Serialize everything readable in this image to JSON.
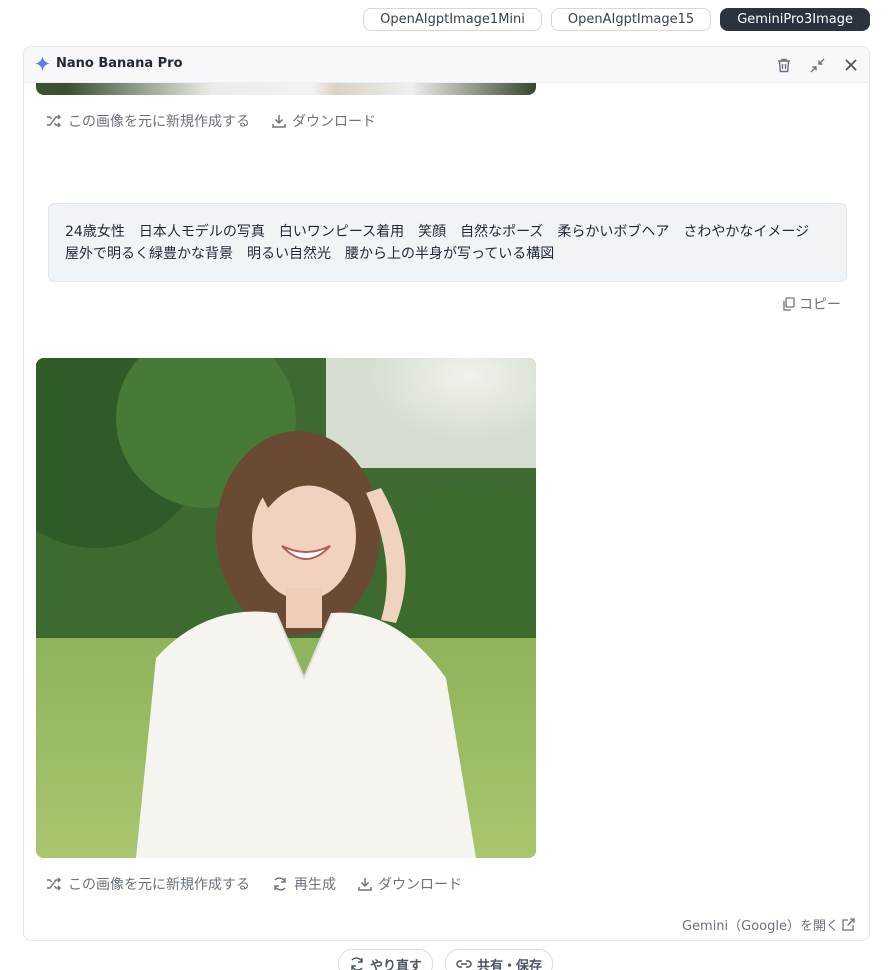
{
  "model_tabs": [
    {
      "label": "OpenAIgptImage1Mini",
      "active": false
    },
    {
      "label": "OpenAIgptImage15",
      "active": false
    },
    {
      "label": "GeminiPro3Image",
      "active": true
    }
  ],
  "panel": {
    "title": "Nano Banana Pro",
    "header_icons": [
      "trash-icon",
      "collapse-icon",
      "close-icon"
    ]
  },
  "first_result": {
    "actions": {
      "create_new": "この画像を元に新規作成する",
      "download": "ダウンロード"
    }
  },
  "prompt": {
    "line1": "24歳女性　日本人モデルの写真　白いワンピース着用　笑顔　自然なポーズ　柔らかいボブヘア　さわやかなイメージ",
    "line2": "屋外で明るく緑豊かな背景　明るい自然光　腰から上の半身が写っている構図",
    "copy_label": "コピー"
  },
  "second_result": {
    "actions": {
      "create_new": "この画像を元に新規作成する",
      "regenerate": "再生成",
      "download": "ダウンロード"
    }
  },
  "footer": {
    "open_gemini": "Gemini（Google）を開く"
  },
  "bottom": {
    "redo": "やり直す",
    "share_save": "共有・保存"
  },
  "colors": {
    "active_tab": "#2b3240",
    "prompt_bg": "#f1f4f7",
    "muted_text": "#6b7280"
  }
}
